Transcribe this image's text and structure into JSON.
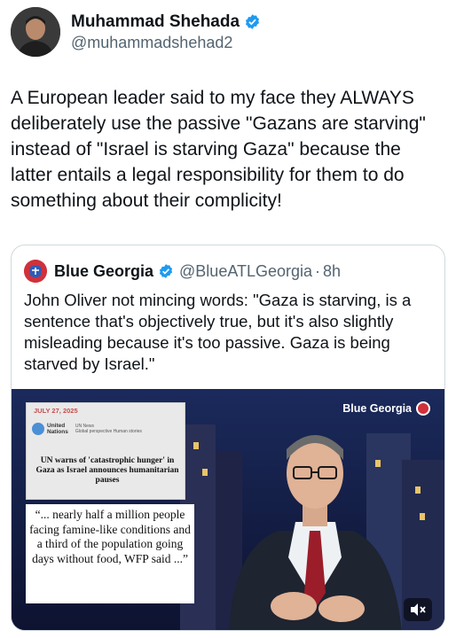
{
  "author": {
    "display_name": "Muhammad Shehada",
    "handle": "@muhammadshehad2",
    "verified": true
  },
  "tweet": {
    "text": "A European leader said to my face they ALWAYS deliberately use the passive \"Gazans are starving\" instead of \"Israel is starving Gaza\" because the latter entails a legal responsibility for them to do something about their complicity!"
  },
  "quoted": {
    "display_name": "Blue Georgia",
    "handle": "@BlueATLGeorgia",
    "separator": "·",
    "time": "8h",
    "verified": true,
    "text": "John Oliver not mincing words: \"Gaza is starving, is a sentence that's objectively true, but it's also slightly misleading because it's too passive. Gaza is being starved by Israel.\"",
    "media": {
      "watermark": "Blue Georgia",
      "news_card": {
        "date": "JULY 27, 2025",
        "org": "United Nations",
        "org_line1": "United",
        "org_line2": "Nations",
        "section": "UN News",
        "tagline": "Global perspective Human stories",
        "headline": "UN warns of 'catastrophic hunger' in Gaza as Israel announces humanitarian pauses"
      },
      "quote_card": "“... nearly half a million people facing famine-like conditions and a third of the population going days without food, WFP said ...”",
      "mute_icon": "speaker-muted-icon"
    }
  },
  "colors": {
    "verified_blue": "#1d9bf0",
    "text_primary": "#0f1419",
    "text_secondary": "#536471",
    "border": "#cfd9de"
  }
}
